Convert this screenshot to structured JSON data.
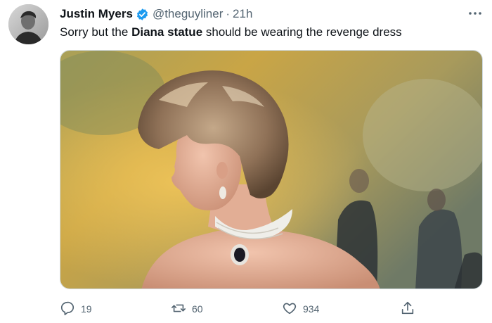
{
  "author": {
    "display_name": "Justin Myers",
    "handle": "@theguyliner",
    "time_separator": "·",
    "time": "21h",
    "verified": true
  },
  "tweet": {
    "text_before": "Sorry but the ",
    "text_bold": "Diana statue",
    "text_after": " should be wearing the revenge dress"
  },
  "media": {
    "kind": "photo"
  },
  "actions": {
    "reply_count": "19",
    "retweet_count": "60",
    "like_count": "934"
  },
  "colors": {
    "text_primary": "#0f1419",
    "text_secondary": "#536471",
    "verified_blue": "#1d9bf0",
    "border": "#cfd9de"
  }
}
